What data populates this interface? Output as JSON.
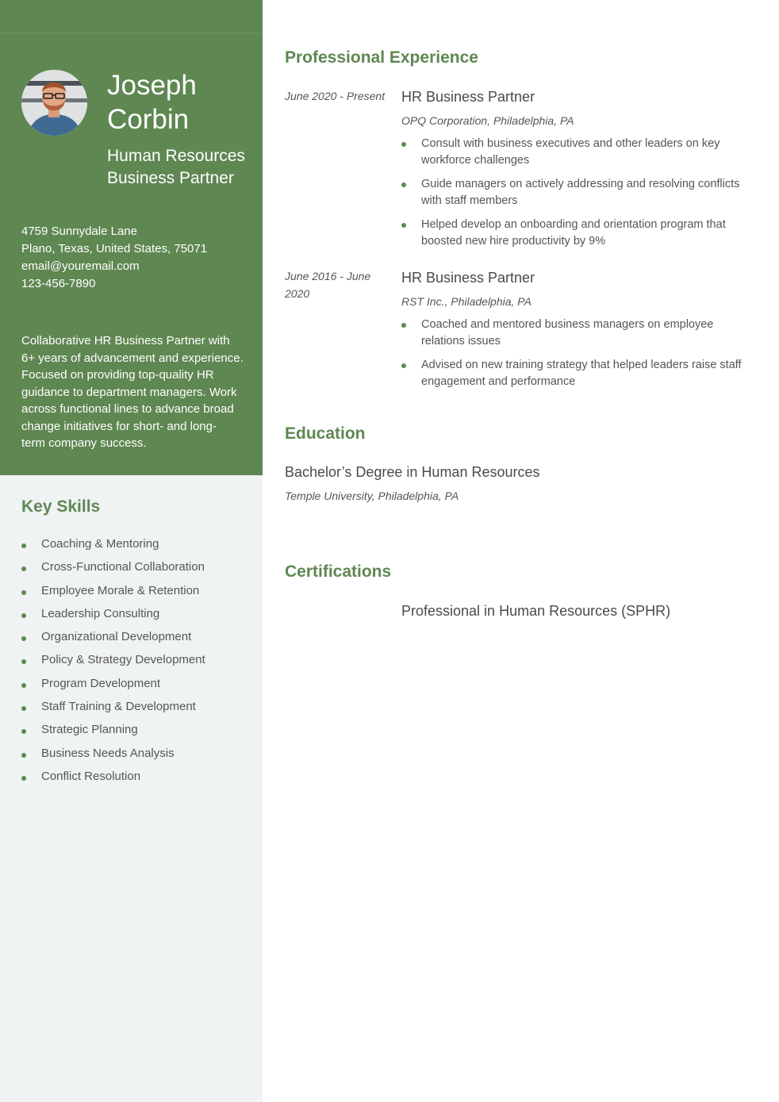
{
  "profile": {
    "first_name": "Joseph",
    "last_name": "Corbin",
    "role": "Human Resources Business Partner",
    "photo": "avatar-photo"
  },
  "contact": {
    "address_line1": "4759 Sunnydale Lane",
    "address_line2": "Plano, Texas, United States, 75071",
    "email": "email@youremail.com",
    "phone": "123-456-7890"
  },
  "summary": "Collaborative HR Business Partner with\n6+ years of advancement and  experience.\nFocused on providing top-quality HR\nguidance to department  managers. Work\nacross functional lines to advance broad\nchange  initiatives for short- and long-\nterm company success.",
  "skills": {
    "title": "Key Skills",
    "items": [
      "Coaching & Mentoring",
      "Cross-Functional Collaboration",
      "Employee Morale & Retention",
      "Leadership Consulting",
      "Organizational Development",
      "Policy & Strategy Development",
      "Program Development",
      "Staff Training & Development",
      "Strategic Planning",
      "Business Needs Analysis",
      "Conflict Resolution"
    ]
  },
  "experience": {
    "title": "Professional Experience",
    "jobs": [
      {
        "date": "June 2020 - Present",
        "title": "HR Business Partner",
        "company": "OPQ Corporation, Philadelphia, PA",
        "bullets": [
          "Consult with business executives and other leaders on key workforce challenges",
          "Guide managers on actively addressing and resolving conflicts with staff members",
          "Helped develop an onboarding and orientation program that boosted new hire productivity by 9%"
        ]
      },
      {
        "date": "June 2016 - June 2020",
        "title": "HR Business Partner",
        "company": "RST Inc., Philadelphia, PA",
        "bullets": [
          "Coached and mentored business managers on employee relations issues",
          "Advised on new training strategy that helped leaders raise staff engagement and performance"
        ]
      }
    ]
  },
  "education": {
    "title": "Education",
    "degree": "Bachelor’s Degree in Human Resources",
    "school": "Temple University, Philadelphia, PA"
  },
  "certifications": {
    "title": "Certifications",
    "items": [
      "Professional in Human Resources (SPHR)"
    ]
  },
  "colors": {
    "accent": "#5f8752",
    "sidebar_bg": "#f0f3f4",
    "text": "#4a4a4a"
  }
}
